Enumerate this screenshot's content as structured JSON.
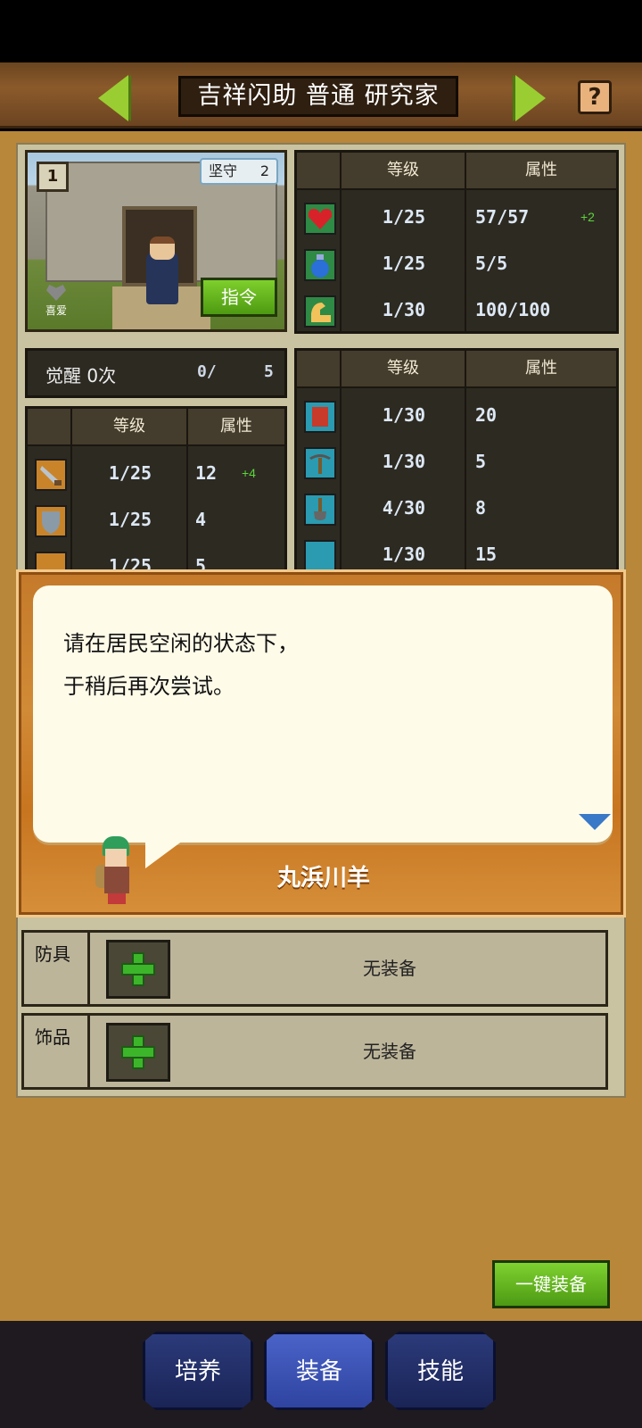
{
  "header": {
    "title": "吉祥闪助 普通 研究家"
  },
  "portrait": {
    "floor": "1",
    "trait": {
      "name": "坚守",
      "level": "2"
    },
    "favorite_label": "喜爱",
    "command_label": "指令"
  },
  "primary_stats": {
    "col_level": "等级",
    "col_attr": "属性",
    "rows": [
      {
        "icon": "heart-icon",
        "level": "1/25",
        "value": "57/57",
        "bonus": "+2"
      },
      {
        "icon": "potion-icon",
        "level": "1/25",
        "value": "5/5",
        "bonus": ""
      },
      {
        "icon": "muscle-icon",
        "level": "1/30",
        "value": "100/100",
        "bonus": ""
      }
    ]
  },
  "awaken": {
    "label": "觉醒 0次",
    "current": "0/",
    "max": "5"
  },
  "combat_stats": {
    "col_level": "等级",
    "col_attr": "属性",
    "rows": [
      {
        "icon": "sword-icon",
        "level": "1/25",
        "value": "12",
        "bonus": "+4"
      },
      {
        "icon": "shield-icon",
        "level": "1/25",
        "value": "4",
        "bonus": ""
      },
      {
        "icon": "bow-icon",
        "level": "1/25",
        "value": "5",
        "bonus": ""
      }
    ]
  },
  "work_stats": {
    "col_level": "等级",
    "col_attr": "属性",
    "rows": [
      {
        "icon": "book-icon",
        "level": "1/30",
        "value": "20"
      },
      {
        "icon": "pickaxe-icon",
        "level": "1/30",
        "value": "5"
      },
      {
        "icon": "shovel-icon",
        "level": "4/30",
        "value": "8"
      },
      {
        "icon": "chest-icon",
        "level": "1/30",
        "value": "15"
      }
    ]
  },
  "dialog": {
    "text": "请在居民空闲的状态下，\n于稍后再次尝试。",
    "speaker": "丸浜川羊"
  },
  "equipment": {
    "slots": [
      {
        "label": "防具",
        "value": "无装备"
      },
      {
        "label": "饰品",
        "value": "无装备"
      }
    ],
    "auto_equip_label": "一键装备"
  },
  "tabs": [
    {
      "label": "培养",
      "active": false
    },
    {
      "label": "装备",
      "active": true
    },
    {
      "label": "技能",
      "active": false
    }
  ],
  "colors": {
    "accent_green": "#7ecf2c",
    "bonus_green": "#5cd43a",
    "tab_active": "#4a63c8"
  }
}
